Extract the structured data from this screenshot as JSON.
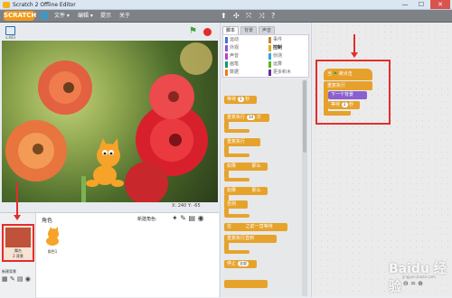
{
  "window": {
    "title": "Scratch 2 Offline Editor",
    "minimize": "—",
    "maximize": "☐",
    "close": "✕"
  },
  "menubar": {
    "logo": "SCRATCH",
    "items": [
      "文件 ▾",
      "编辑 ▾",
      "提示",
      "关于"
    ],
    "tools": [
      "⬆",
      "✣",
      "⤧",
      "⤨",
      "?"
    ]
  },
  "stage": {
    "version": "v.443",
    "coords": "X: 240  Y: -65"
  },
  "sprites": {
    "label": "角色",
    "new_sprite_label": "新建角色:",
    "stage_label": "舞台",
    "stage_backdrops": "2 背景",
    "sprite_name": "角色1",
    "new_backdrop_label": "新建背景"
  },
  "tabs": [
    "脚本",
    "背景",
    "声音"
  ],
  "categories": [
    {
      "label": "运动",
      "color": "#4a6cd4"
    },
    {
      "label": "事件",
      "color": "#c88330"
    },
    {
      "label": "外观",
      "color": "#8a55d7"
    },
    {
      "label": "控制",
      "color": "#e1a91a"
    },
    {
      "label": "声音",
      "color": "#bb42c3"
    },
    {
      "label": "侦测",
      "color": "#2ca5e2"
    },
    {
      "label": "画笔",
      "color": "#0e9a6c"
    },
    {
      "label": "运算",
      "color": "#5cb712"
    },
    {
      "label": "数据",
      "color": "#ee7d16"
    },
    {
      "label": "更多积木",
      "color": "#632d99"
    }
  ],
  "palette": {
    "wait": "等待",
    "wait_val": "1",
    "wait_unit": "秒",
    "repeat": "重复执行",
    "repeat_val": "10",
    "repeat_unit": "次",
    "forever": "重复执行",
    "if_then": "如果",
    "then": "那么",
    "if_else": "如果",
    "else": "否则",
    "wait_until": "在",
    "wait_until_tail": "之前一直等待",
    "repeat_until": "重复执行直到",
    "stop": "停止",
    "stop_val": "全部"
  },
  "script": {
    "hat": "当",
    "hat_tail": "被点击",
    "forever": "重复执行",
    "next_costume": "下一个背景",
    "wait": "等待",
    "wait_val": "2",
    "wait_unit": "秒"
  },
  "zoom": "⊖ = ⊕",
  "watermark": "Baidu 经验",
  "watermark_sub": "jingyan.baidu.com"
}
